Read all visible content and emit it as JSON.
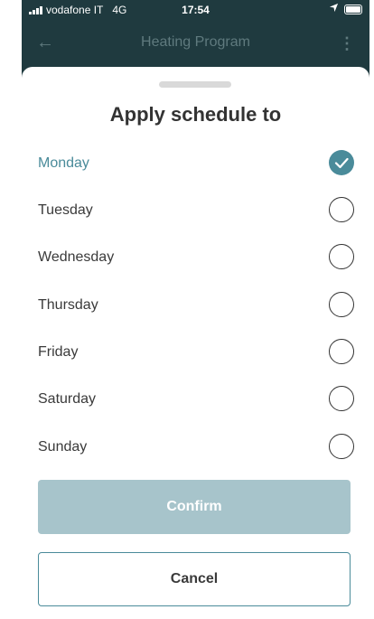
{
  "status_bar": {
    "carrier": "vodafone IT",
    "network": "4G",
    "time": "17:54"
  },
  "app_bar": {
    "title": "Heating Program",
    "back_icon": "arrow-left-icon",
    "more_icon": "more-vertical-icon"
  },
  "sheet": {
    "title": "Apply schedule to",
    "days": [
      {
        "label": "Monday",
        "checked": true
      },
      {
        "label": "Tuesday",
        "checked": false
      },
      {
        "label": "Wednesday",
        "checked": false
      },
      {
        "label": "Thursday",
        "checked": false
      },
      {
        "label": "Friday",
        "checked": false
      },
      {
        "label": "Saturday",
        "checked": false
      },
      {
        "label": "Sunday",
        "checked": false
      }
    ],
    "confirm_label": "Confirm",
    "cancel_label": "Cancel"
  },
  "colors": {
    "accent": "#4a8b9a",
    "confirm_bg": "#a7c4cb",
    "appbar_bg": "#1f3a3f"
  }
}
